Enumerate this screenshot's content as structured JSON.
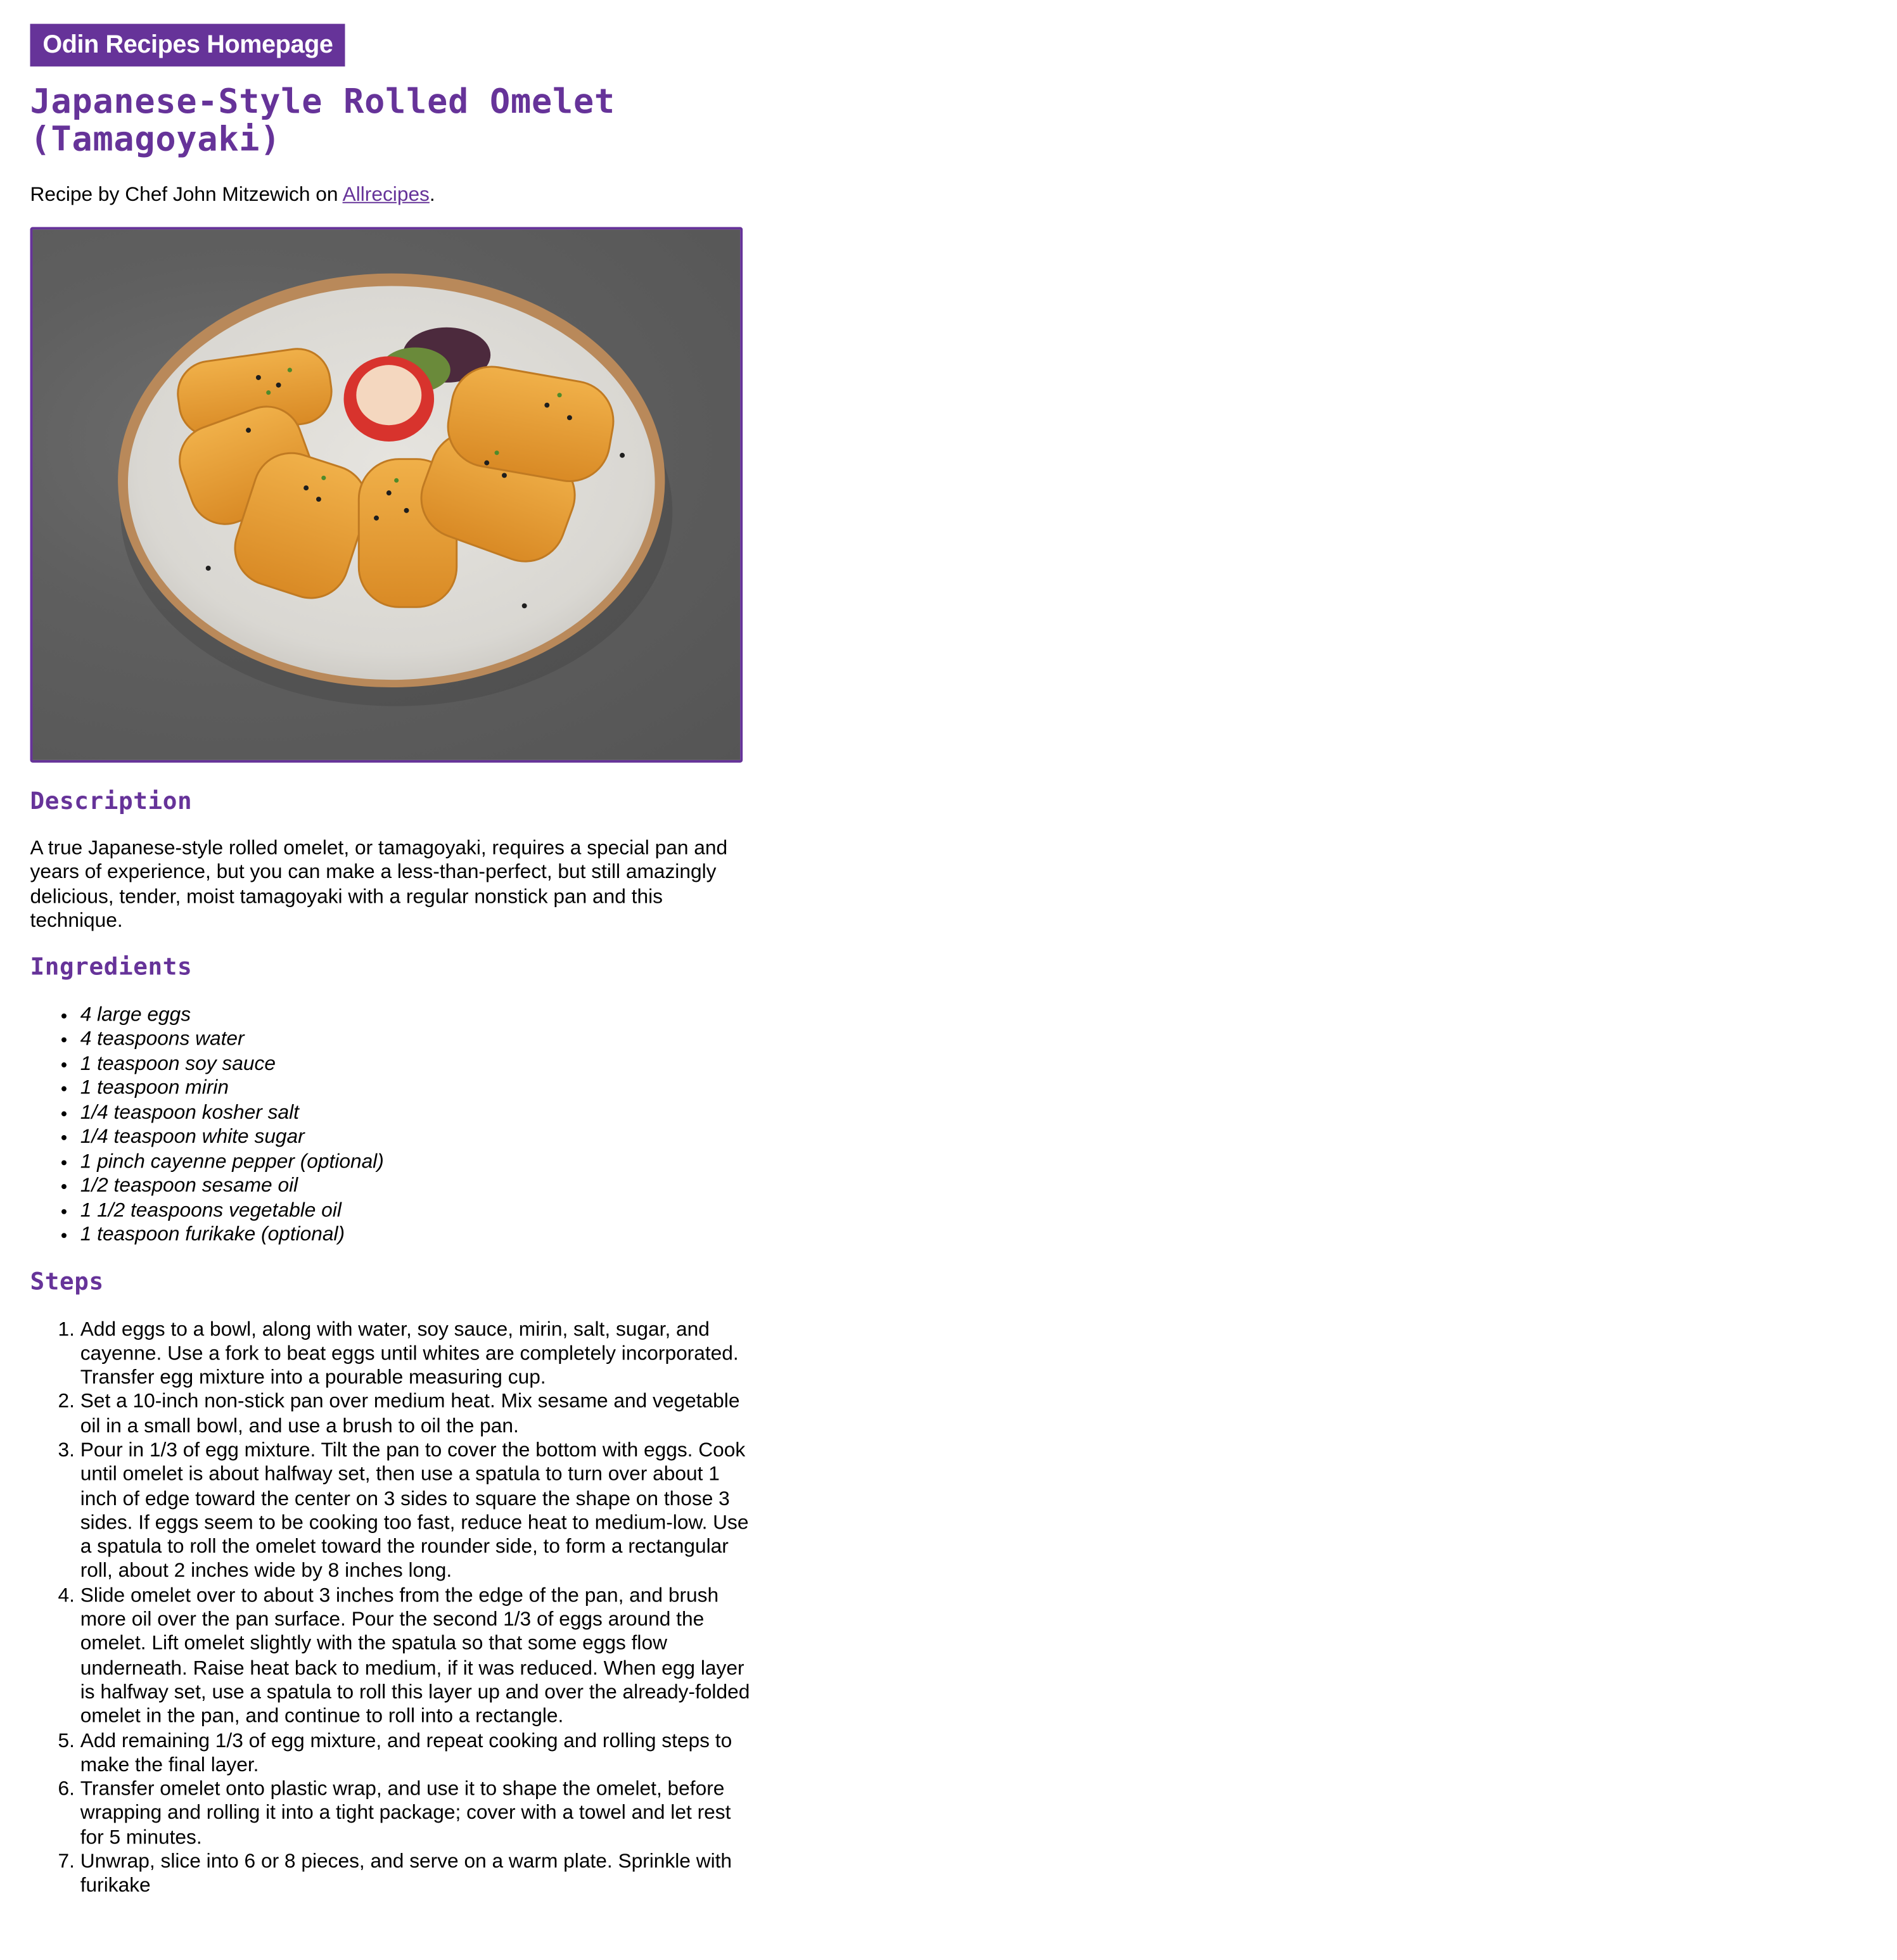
{
  "nav": {
    "home_label": "Odin Recipes Homepage"
  },
  "recipe": {
    "title": "Japanese-Style Rolled Omelet (Tamagoyaki)",
    "byline_prefix": "Recipe by Chef John Mitzewich on ",
    "source_link_label": "Allrecipes",
    "byline_suffix": ".",
    "image_alt": "Tamagoyaki"
  },
  "description": {
    "heading": "Description",
    "text": "A true Japanese-style rolled omelet, or tamagoyaki, requires a special pan and years of experience, but you can make a less-than-perfect, but still amazingly delicious, tender, moist tamagoyaki with a regular nonstick pan and this technique."
  },
  "ingredients": {
    "heading": "Ingredients",
    "items": [
      "4 large eggs",
      "4 teaspoons water",
      "1 teaspoon soy sauce",
      "1 teaspoon mirin",
      "1/4 teaspoon kosher salt",
      "1/4 teaspoon white sugar",
      "1 pinch cayenne pepper (optional)",
      "1/2 teaspoon sesame oil",
      "1 1/2 teaspoons vegetable oil",
      "1 teaspoon furikake (optional)"
    ]
  },
  "steps": {
    "heading": "Steps",
    "items": [
      "Add eggs to a bowl, along with water, soy sauce, mirin, salt, sugar, and cayenne. Use a fork to beat eggs until whites are completely incorporated. Transfer egg mixture into a pourable measuring cup.",
      "Set a 10-inch non-stick pan over medium heat. Mix sesame and vegetable oil in a small bowl, and use a brush to oil the pan.",
      "Pour in 1/3 of egg mixture. Tilt the pan to cover the bottom with eggs. Cook until omelet is about halfway set, then use a spatula to turn over about 1 inch of edge toward the center on 3 sides to square the shape on those 3 sides. If eggs seem to be cooking too fast, reduce heat to medium-low. Use a spatula to roll the omelet toward the rounder side, to form a rectangular roll, about 2 inches wide by 8 inches long.",
      "Slide omelet over to about 3 inches from the edge of the pan, and brush more oil over the pan surface. Pour the second 1/3 of eggs around the omelet. Lift omelet slightly with the spatula so that some eggs flow underneath. Raise heat back to medium, if it was reduced. When egg layer is halfway set, use a spatula to roll this layer up and over the already-folded omelet in the pan, and continue to roll into a rectangle.",
      "Add remaining 1/3 of egg mixture, and repeat cooking and rolling steps to make the final layer.",
      "Transfer omelet onto plastic wrap, and use it to shape the omelet, before wrapping and rolling it into a tight package; cover with a towel and let rest for 5 minutes.",
      "Unwrap, slice into 6 or 8 pieces, and serve on a warm plate. Sprinkle with furikake"
    ]
  },
  "colors": {
    "accent": "#663399",
    "text": "#000000",
    "background": "#ffffff"
  }
}
